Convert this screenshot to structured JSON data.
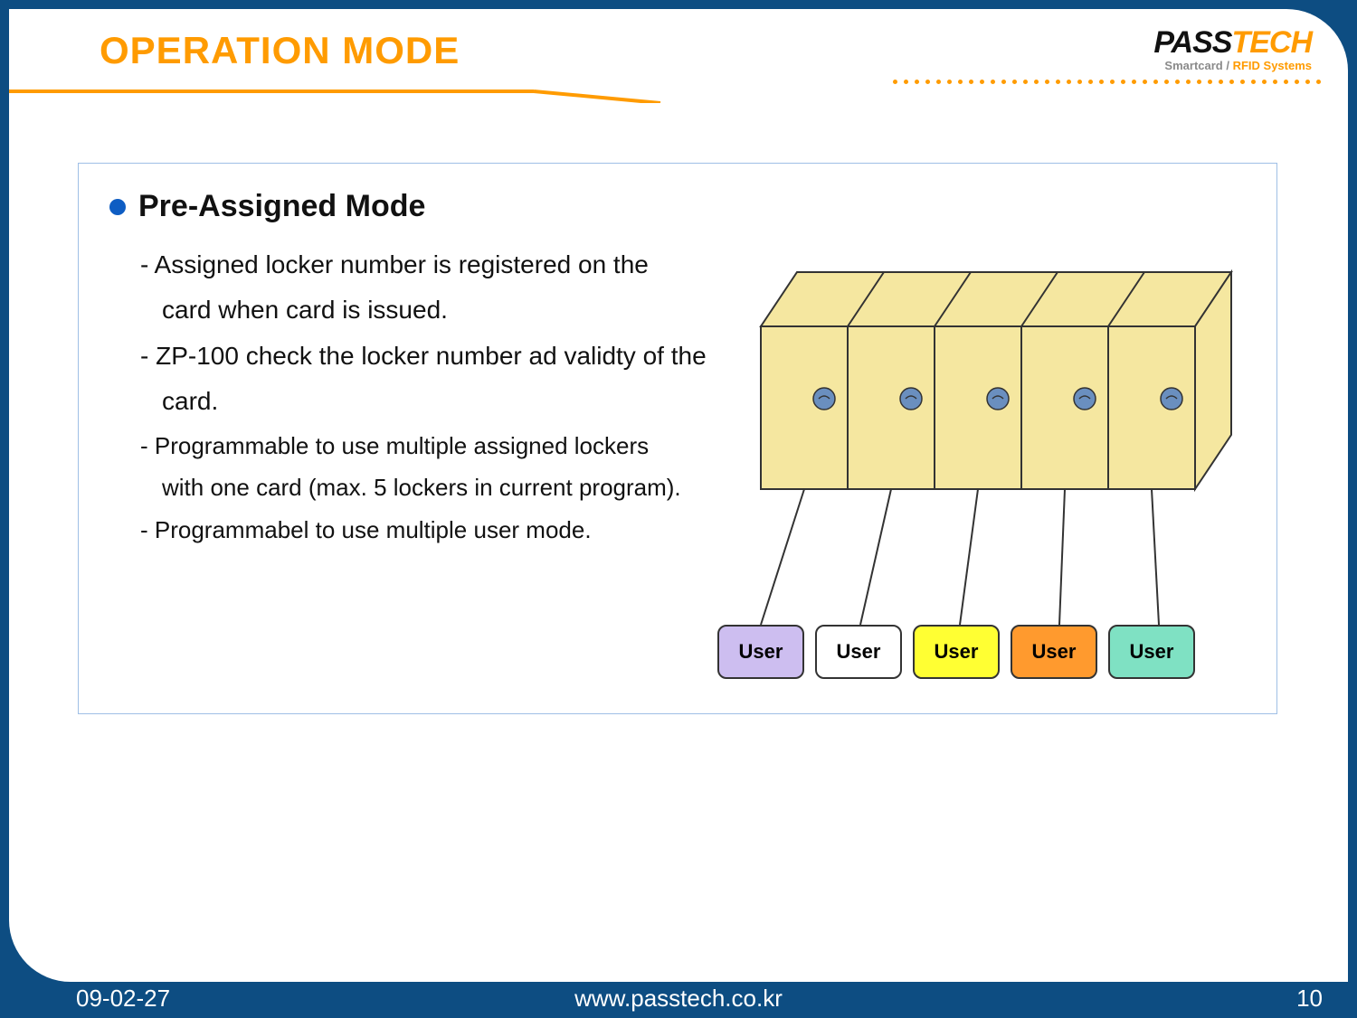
{
  "title": "OPERATION MODE",
  "logo": {
    "pass": "PASS",
    "tech": "TECH",
    "sub_a": "Smartcard / ",
    "sub_b": "RFID Systems"
  },
  "heading": "Pre-Assigned Mode",
  "lines": {
    "l1a": "- Assigned locker number is registered on the",
    "l1b": "card when card is issued.",
    "l2a": "- ZP-100 check the locker number ad validty of the",
    "l2b": "card.",
    "l3a": "- Programmable to use multiple assigned lockers",
    "l3b": "with one card (max. 5 lockers in current program).",
    "l4": "- Programmabel to use multiple user mode."
  },
  "diagram": {
    "user_label": "User",
    "users": [
      {
        "color": "#cdbef0"
      },
      {
        "color": "#ffffff"
      },
      {
        "color": "#ffff33"
      },
      {
        "color": "#ff9a2e"
      },
      {
        "color": "#7fe1c3"
      }
    ],
    "locker_count": 5
  },
  "footer": {
    "date": "09-02-27",
    "url": "www.passtech.co.kr",
    "page": "10"
  },
  "colors": {
    "bg": "#0d4d82",
    "accent": "#ff9b00",
    "bullet": "#0e5dc3",
    "border": "#9fbfe6"
  }
}
